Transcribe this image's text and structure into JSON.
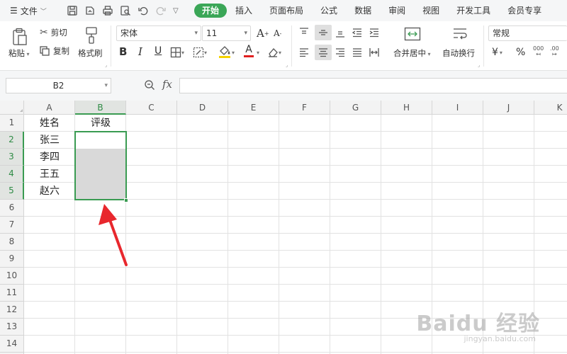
{
  "menu": {
    "file_label": "文件",
    "tabs": [
      "开始",
      "插入",
      "页面布局",
      "公式",
      "数据",
      "审阅",
      "视图",
      "开发工具",
      "会员专享"
    ],
    "active_tab": "开始"
  },
  "ribbon": {
    "paste": "粘贴",
    "cut": "剪切",
    "copy": "复制",
    "format_painter": "格式刷",
    "font_name": "宋体",
    "font_size": "11",
    "merge_center": "合并居中",
    "wrap_text": "自动换行",
    "number_format": "常规",
    "currency_symbol": "¥",
    "percent_symbol": "%",
    "bold": "B",
    "italic": "I",
    "underline": "U",
    "increase_font": "A",
    "decrease_font": "A",
    "font_color": "A"
  },
  "formula_bar": {
    "name_box": "B2",
    "fx": "fx",
    "content": ""
  },
  "sheet": {
    "columns": [
      "A",
      "B",
      "C",
      "D",
      "E",
      "F",
      "G",
      "H",
      "I",
      "J",
      "K"
    ],
    "rows": [
      "1",
      "2",
      "3",
      "4",
      "5",
      "6",
      "7",
      "8",
      "9",
      "10",
      "11",
      "12",
      "13",
      "14",
      "15",
      "16",
      "17"
    ],
    "cells": {
      "A1": "姓名",
      "B1": "评级",
      "A2": "张三",
      "A3": "李四",
      "A4": "王五",
      "A5": "赵六"
    },
    "selected_range": "B2:B5"
  },
  "watermark": {
    "brand": "Baidu 经验",
    "url": "jingyan.baidu.com"
  },
  "colors": {
    "accent": "#3aa657",
    "selection_border": "#3a9b52",
    "arrow": "#e8272d"
  }
}
